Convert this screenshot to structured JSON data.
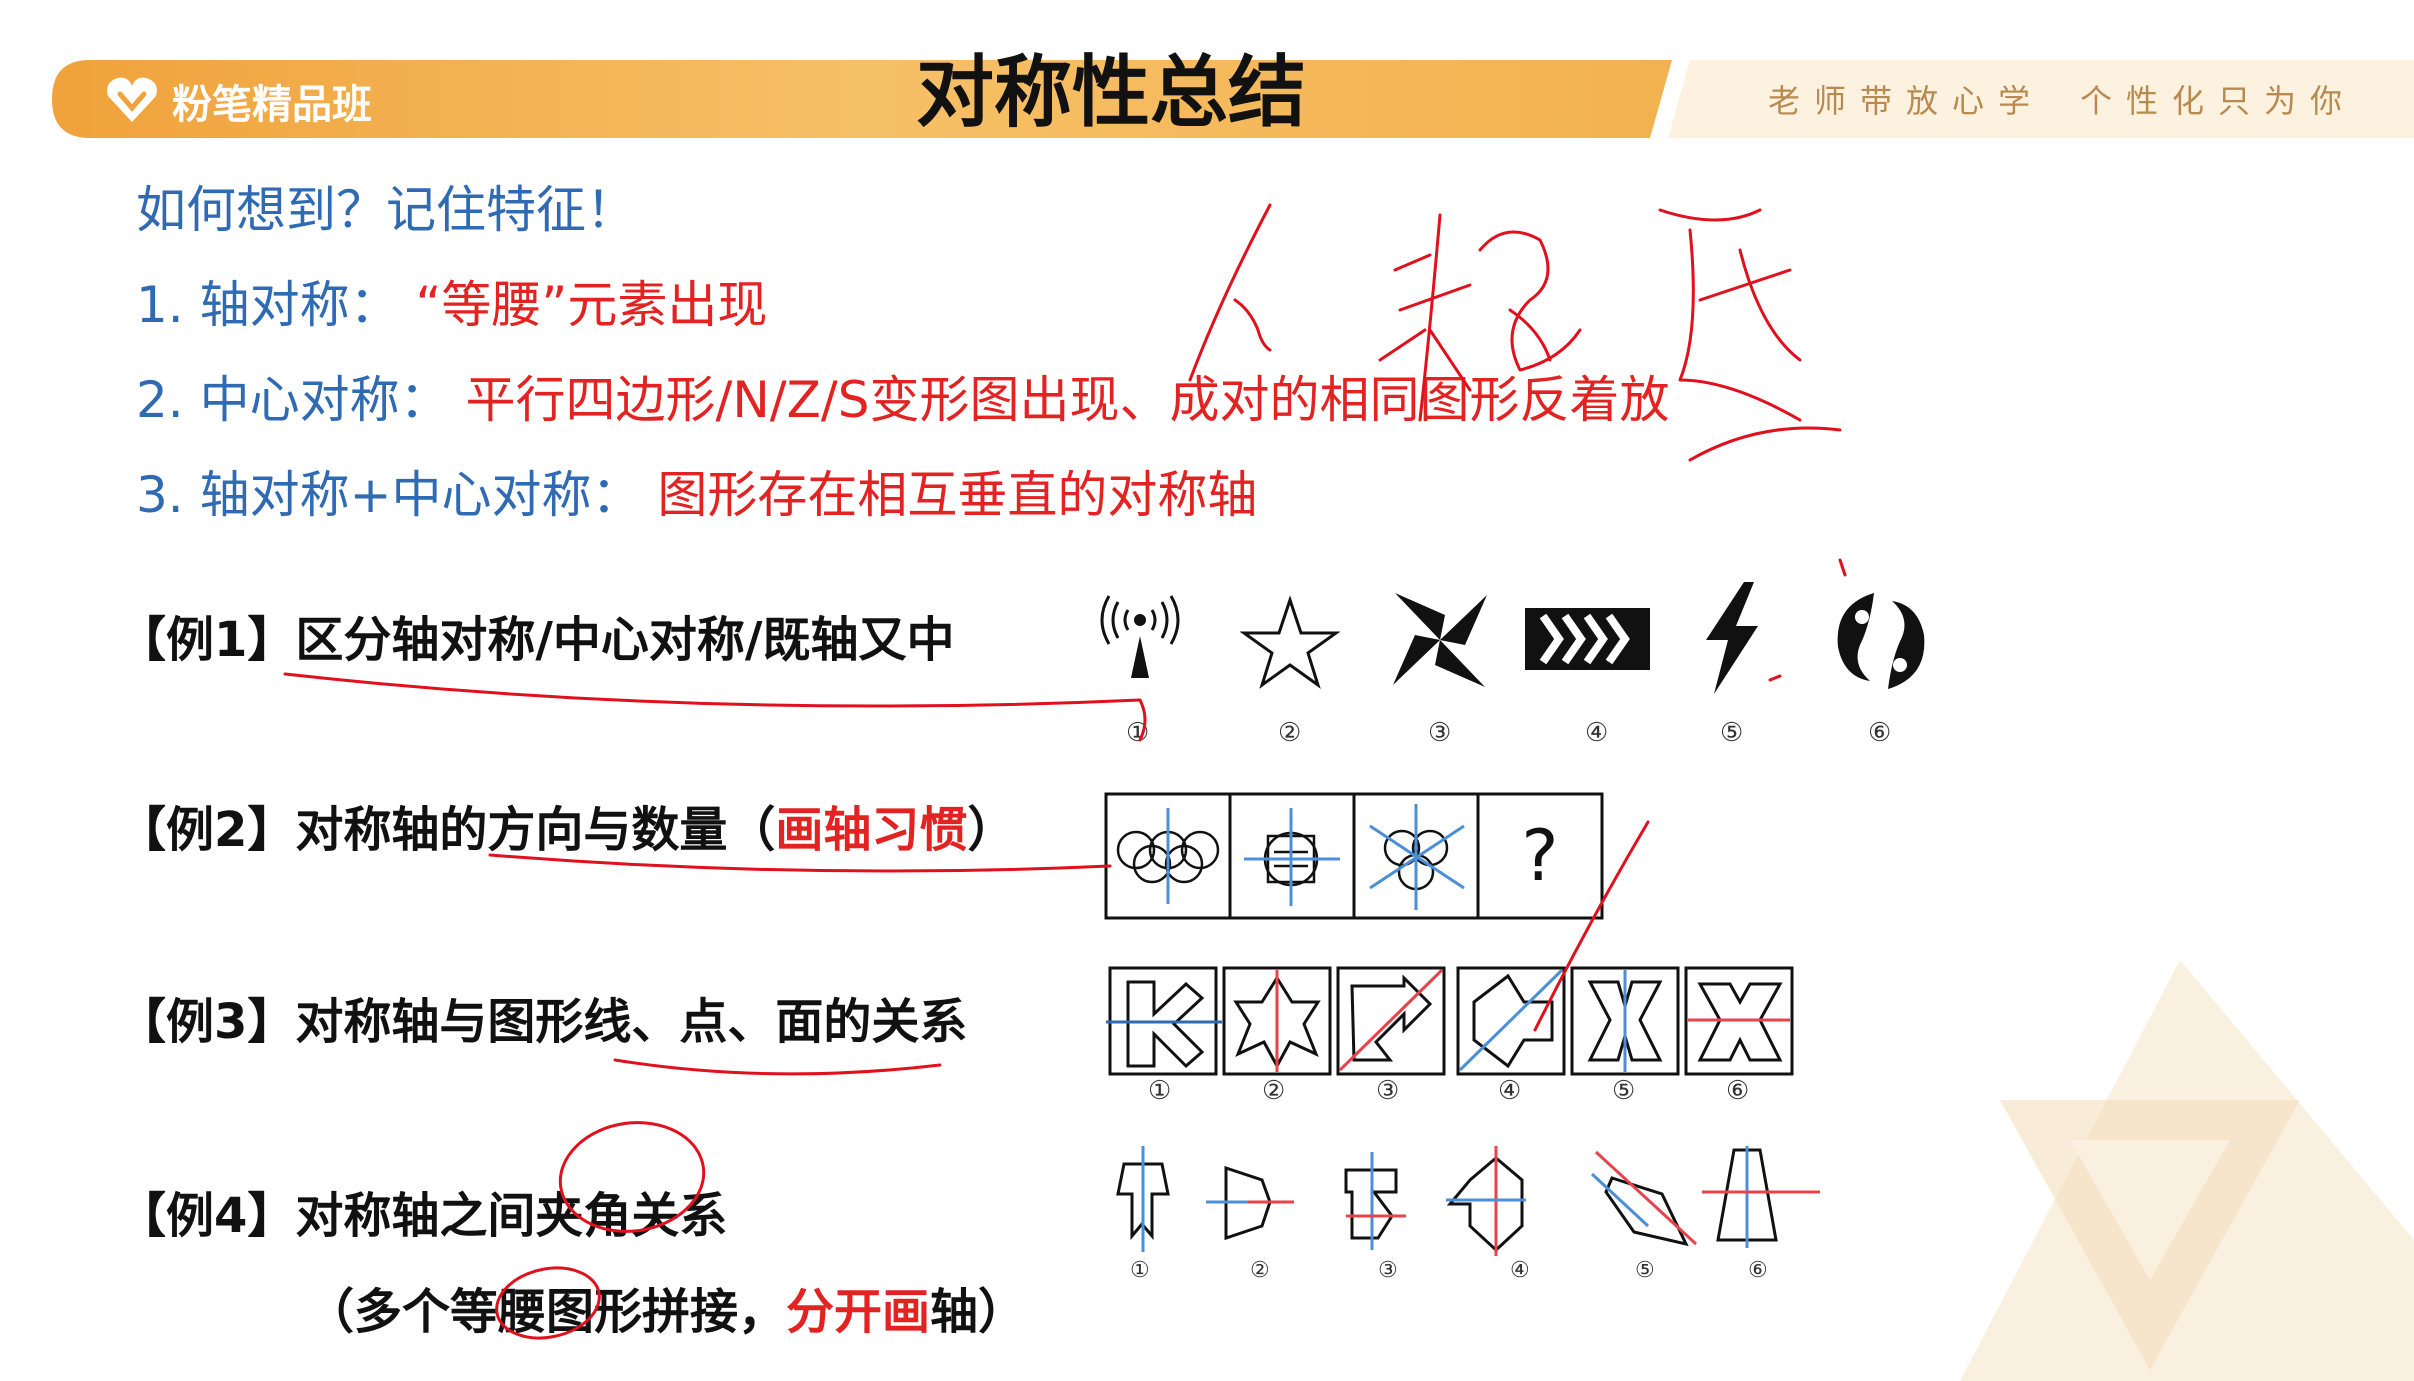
{
  "header": {
    "brand": "粉笔精品班",
    "title": "对称性总结",
    "slogan_1": "老师带放心学",
    "slogan_2": "个性化只为你"
  },
  "intro": {
    "question": "如何想到？记住特征！",
    "rules": [
      {
        "prefix": "1. 轴对称：",
        "detail": "“等腰”元素出现"
      },
      {
        "prefix": "2. 中心对称：",
        "detail": "平行四边形/N/Z/S变形图出现、成对的相同图形反着放"
      },
      {
        "prefix": "3. 轴对称+中心对称：",
        "detail": "图形存在相互垂直的对称轴"
      }
    ]
  },
  "examples": {
    "ex1": {
      "text": "【例1】区分轴对称/中心对称/既轴又中"
    },
    "ex2": {
      "text_a": "【例2】对称轴的方向与数量（",
      "text_red": "画轴习惯",
      "text_b": "）"
    },
    "ex3": {
      "text": "【例3】对称轴与图形线、点、面的关系"
    },
    "ex4": {
      "line1": "【例4】对称轴之间夹角关系",
      "line2_a": "（多个等腰图形拼接，",
      "line2_red": "分开画",
      "line2_b": "轴）"
    }
  },
  "figures": {
    "ex1_labels": [
      "①",
      "②",
      "③",
      "④",
      "⑤",
      "⑥"
    ],
    "ex2_question": "?",
    "ex3_labels": [
      "①",
      "②",
      "③",
      "④",
      "⑤",
      "⑥"
    ],
    "ex4_labels": [
      "①",
      "②",
      "③",
      "④",
      "⑤",
      "⑥"
    ]
  },
  "colors": {
    "brand_orange": "#f1a53e",
    "axis_blue": "#4a8fd8",
    "axis_red": "#e8434a",
    "text_blue": "#2f6ab4",
    "text_red": "#e32222",
    "ink_red": "#e0101c"
  },
  "icons": [
    "heart-logo-icon",
    "antenna-icon",
    "star-icon",
    "pinwheel-icon",
    "chevron-strip-icon",
    "lightning-icon",
    "yin-yang-icon"
  ]
}
